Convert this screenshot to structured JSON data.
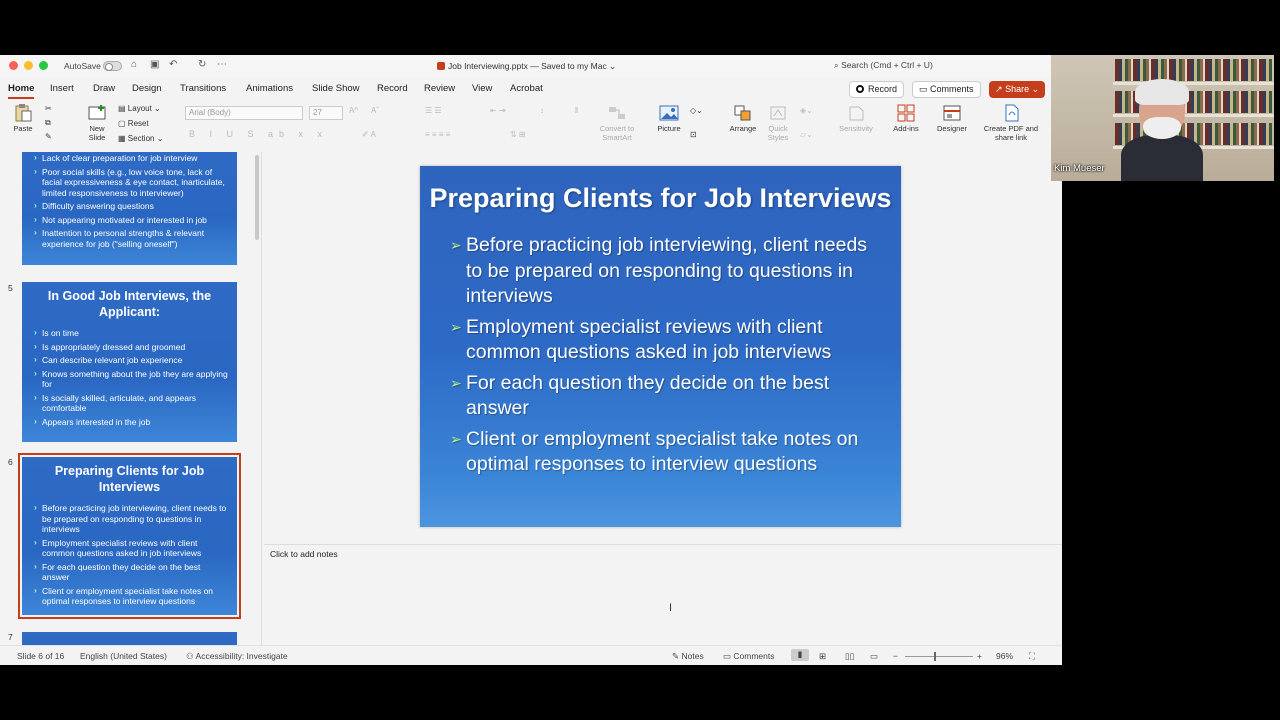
{
  "titlebar": {
    "autosave_label": "AutoSave",
    "doc_title": "Job Interviewing.pptx — Saved to my Mac",
    "search_placeholder": "Search (Cmd + Ctrl + U)"
  },
  "tabs": [
    "Home",
    "Insert",
    "Draw",
    "Design",
    "Transitions",
    "Animations",
    "Slide Show",
    "Record",
    "Review",
    "View",
    "Acrobat"
  ],
  "actions": {
    "record": "Record",
    "comments": "Comments",
    "share": "Share"
  },
  "ribbon": {
    "paste": "Paste",
    "new_slide": "New Slide",
    "layout": "Layout",
    "reset": "Reset",
    "section": "Section",
    "font_name": "Arial (Body)",
    "font_size": "27",
    "convert_smartart": "Convert to SmartArt",
    "picture": "Picture",
    "arrange": "Arrange",
    "quick_styles": "Quick Styles",
    "sensitivity": "Sensitivity",
    "addins": "Add-ins",
    "designer": "Designer",
    "create_pdf": "Create PDF and share link"
  },
  "thumbnails": {
    "slide4_bullets": [
      "Lack of clear preparation for job interview",
      "Poor social skills (e.g., low voice tone, lack of facial expressiveness & eye contact, inarticulate, limited responsiveness to interviewer)",
      "Difficulty answering questions",
      "Not appearing motivated or interested in job",
      "Inattention to personal strengths & relevant experience for job (\"selling oneself\")"
    ],
    "slide5": {
      "number": "5",
      "title": "In Good Job Interviews, the Applicant:",
      "bullets": [
        "Is on time",
        "Is appropriately dressed and groomed",
        "Can describe relevant job experience",
        "Knows something about the job they are applying for",
        "Is socially skilled, articulate, and appears comfortable",
        "Appears interested in the job"
      ]
    },
    "slide6": {
      "number": "6",
      "title": "Preparing Clients for Job Interviews",
      "bullets": [
        "Before practicing job interviewing, client needs to be prepared on responding to questions in interviews",
        "Employment specialist reviews with client common questions asked in job interviews",
        "For each question they decide on the best answer",
        "Client or employment specialist take notes on optimal responses to interview questions"
      ]
    },
    "slide7_number": "7"
  },
  "slide": {
    "title": "Preparing Clients for Job Interviews",
    "bullets": [
      "Before practicing job interviewing, client needs to be prepared on responding to questions in interviews",
      "Employment specialist reviews with client common questions asked in job interviews",
      "For each question they decide on the best answer",
      "Client or employment specialist take notes on optimal responses to interview questions"
    ]
  },
  "notes_placeholder": "Click to add notes",
  "status": {
    "slide_count": "Slide 6 of 16",
    "language": "English (United States)",
    "accessibility": "Accessibility: Investigate",
    "notes": "Notes",
    "comments": "Comments",
    "zoom": "96%"
  },
  "webcam": {
    "name": "Kim Mueser"
  },
  "colors": {
    "accent": "#c43e1c",
    "slide_blue": "#2f64be",
    "bullet_green": "#b9f28a"
  }
}
